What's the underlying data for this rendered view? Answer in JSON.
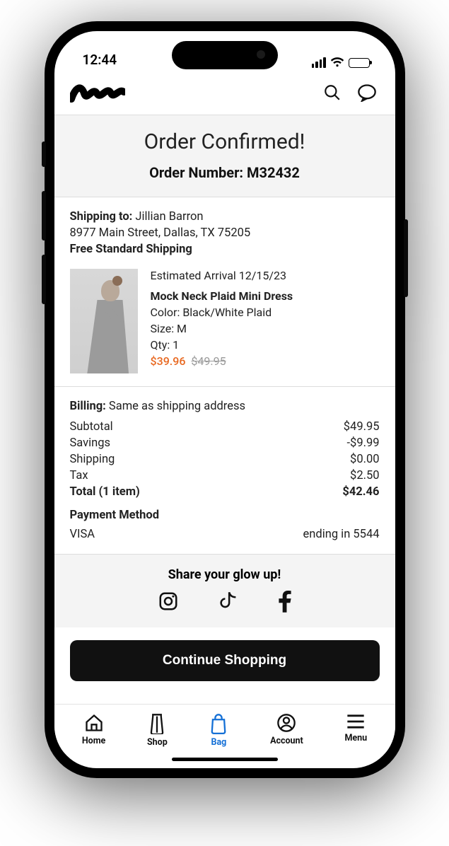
{
  "status": {
    "time": "12:44"
  },
  "header": {
    "title": "Order Confirmed!",
    "order_number_label": "Order Number: M32432"
  },
  "shipping": {
    "label": "Shipping to:",
    "name": "Jillian Barron",
    "address": "8977 Main Street, Dallas, TX 75205",
    "method": "Free Standard Shipping"
  },
  "product": {
    "estimated": "Estimated Arrival 12/15/23",
    "name": "Mock Neck Plaid Mini Dress",
    "color": "Color: Black/White Plaid",
    "size": "Size: M",
    "qty": "Qty: 1",
    "price_sale": "$39.96",
    "price_orig": "$49.95"
  },
  "billing": {
    "label": "Billing:",
    "value": "Same as shipping address"
  },
  "totals": {
    "subtotal_label": "Subtotal",
    "subtotal": "$49.95",
    "savings_label": "Savings",
    "savings": "-$9.99",
    "shipping_label": "Shipping",
    "shipping": "$0.00",
    "tax_label": "Tax",
    "tax": "$2.50",
    "total_label": "Total (1 item)",
    "total": "$42.46"
  },
  "payment": {
    "title": "Payment Method",
    "brand": "VISA",
    "ending": "ending in 5544"
  },
  "share": {
    "title": "Share your glow up!"
  },
  "cta": {
    "label": "Continue Shopping"
  },
  "tabs": {
    "home": "Home",
    "shop": "Shop",
    "bag": "Bag",
    "account": "Account",
    "menu": "Menu"
  }
}
